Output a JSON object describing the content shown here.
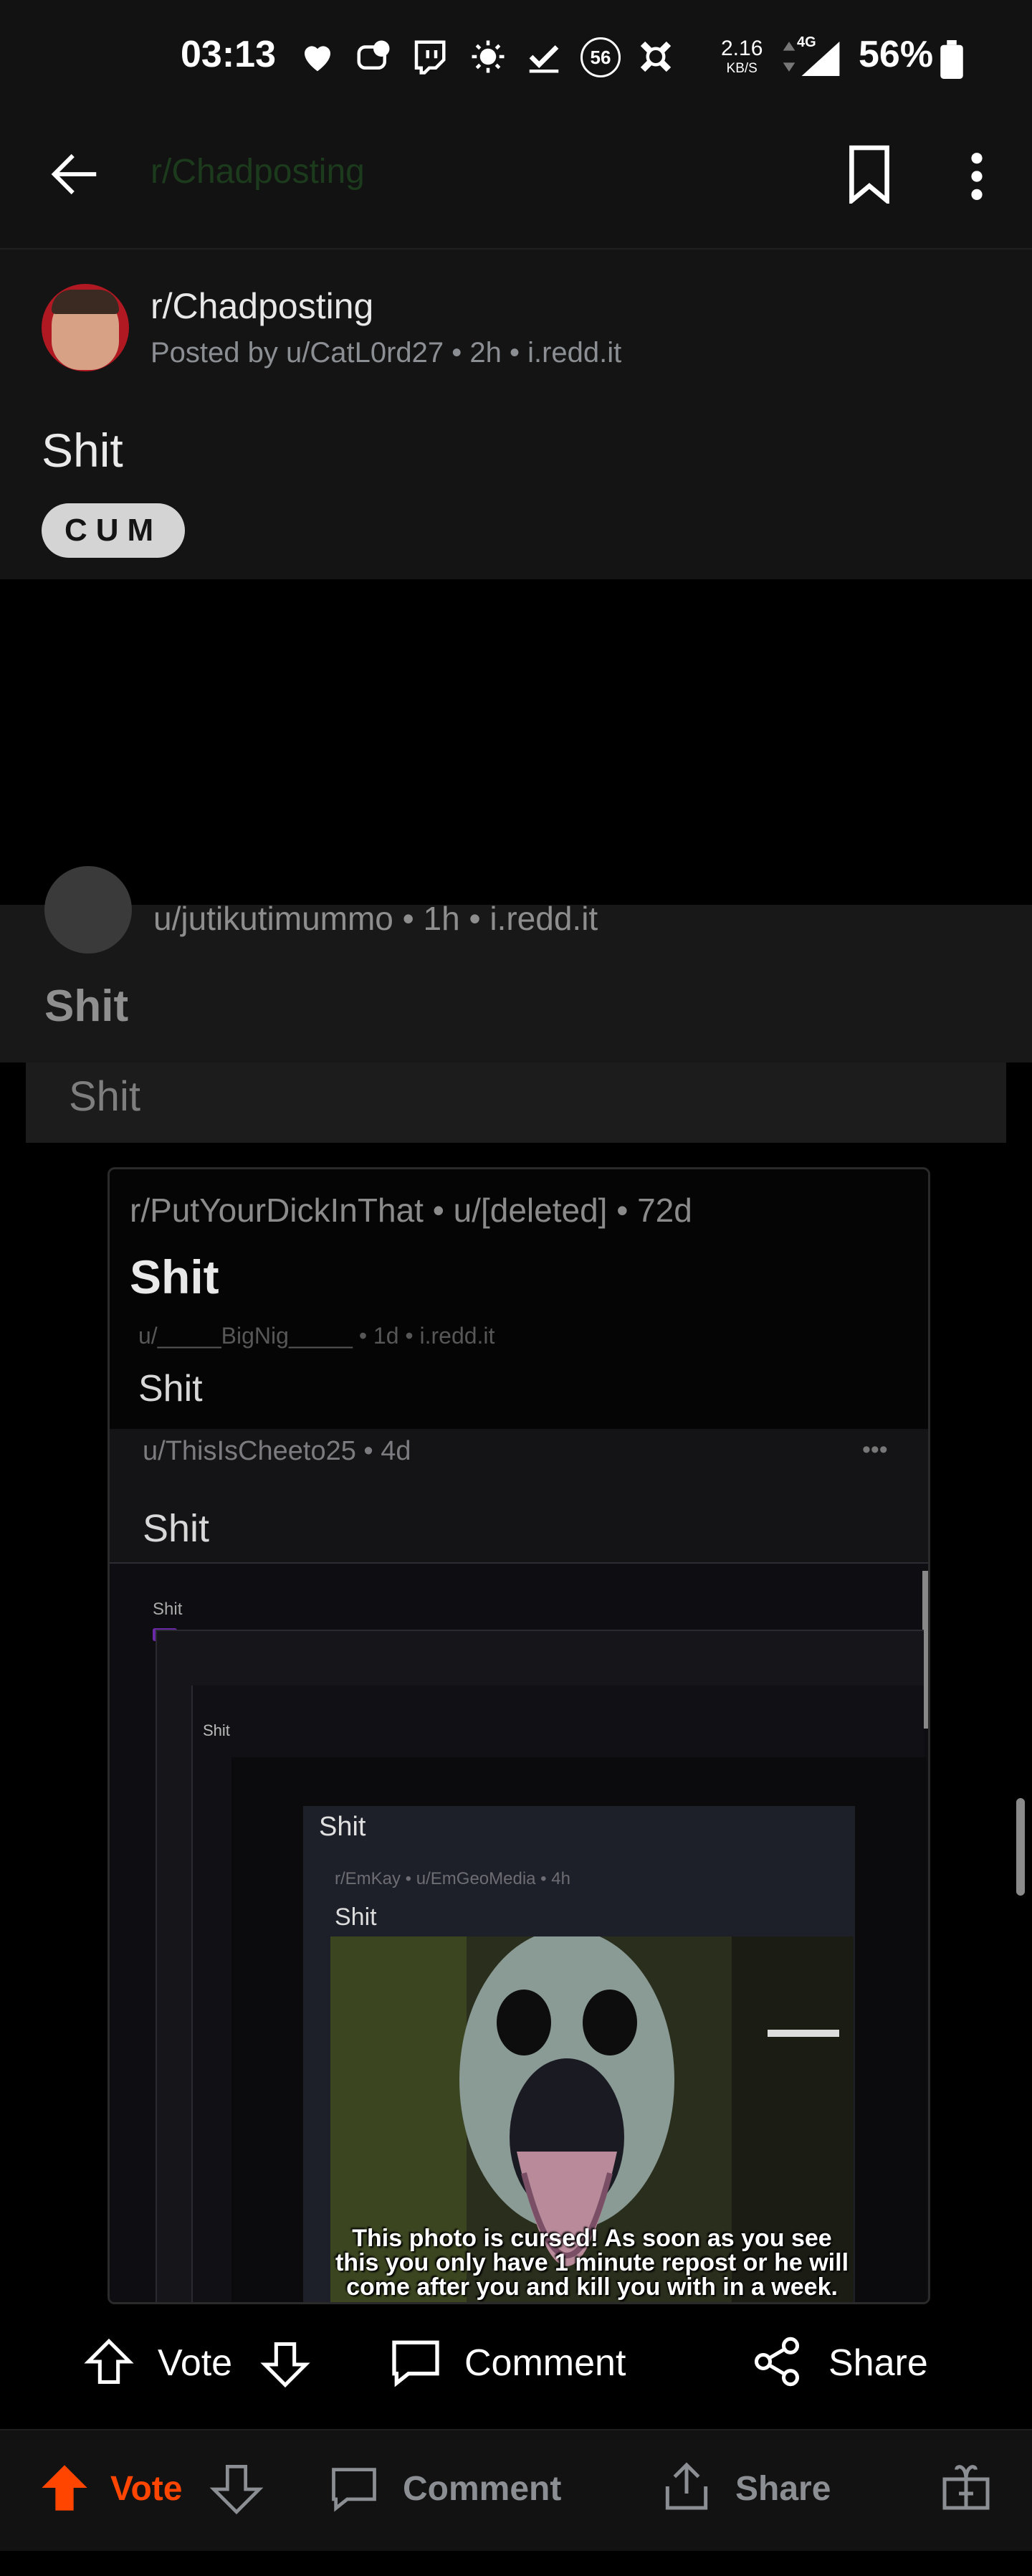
{
  "status_bar": {
    "time": "03:13",
    "notif_badge": "56",
    "speed_value": "2.16",
    "speed_unit": "KB/S",
    "network": "4G",
    "battery": "56%"
  },
  "post": {
    "subreddit": "r/Chadposting",
    "meta": "Posted by u/CatL0rd27 • 2h • i.redd.it",
    "title": "Shit",
    "flair": "CUM",
    "ghost_subreddit": "r/Chadposting"
  },
  "media": {
    "meta": "u/jutikutimummo • 1h • i.redd.it",
    "title": "Shit",
    "box_title": "Shit",
    "n1": {
      "meta": "r/PutYourDickInThat • u/[deleted] • 72d",
      "title": "Shit",
      "sub_meta": "u/_____BigNig_____ • 1d • i.redd.it",
      "sub_title": "Shit"
    },
    "n2": {
      "meta": "u/ThisIsCheeto25 • 4d",
      "title": "Shit"
    },
    "n3": {
      "title": "Shit"
    },
    "n5": {
      "title": "Shit"
    },
    "n7": {
      "title": "Shit",
      "meta": "r/EmKay • u/EmGeoMedia • 4h",
      "sub_title": "Shit"
    },
    "caption": "This photo is cursed! As soon as you see this you only have 1 minute repost or he will come after you and kill you with in a week.",
    "actions": {
      "vote": "Vote",
      "comment": "Comment",
      "share": "Share"
    }
  },
  "bottom_bar": {
    "vote": "Vote",
    "comment": "Comment",
    "share": "Share"
  },
  "colors": {
    "upvote_active": "#ff4500",
    "background": "#000000",
    "card": "#141414"
  }
}
